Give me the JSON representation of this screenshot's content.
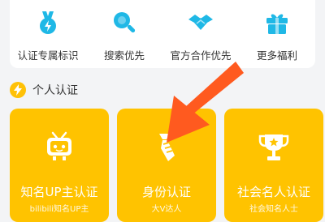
{
  "benefits": [
    {
      "label": "认证专属标识",
      "icon": "badge-medal-icon"
    },
    {
      "label": "搜索优先",
      "icon": "search-icon"
    },
    {
      "label": "官方合作优先",
      "icon": "handshake-icon"
    },
    {
      "label": "更多福利",
      "icon": "gift-icon"
    }
  ],
  "section": {
    "title": "个人认证",
    "icon": "lightning-icon"
  },
  "cards": [
    {
      "title": "知名UP主认证",
      "subtitle": "bilibili知名UP主",
      "icon": "tv-robot-icon"
    },
    {
      "title": "身份认证",
      "subtitle": "大V达人",
      "icon": "tie-icon"
    },
    {
      "title": "社会名人认证",
      "subtitle": "社会知名人士",
      "icon": "trophy-icon"
    }
  ],
  "colors": {
    "accent": "#ffc300",
    "icon_blue": "#1fb8e6",
    "arrow": "#ff5a1f"
  }
}
